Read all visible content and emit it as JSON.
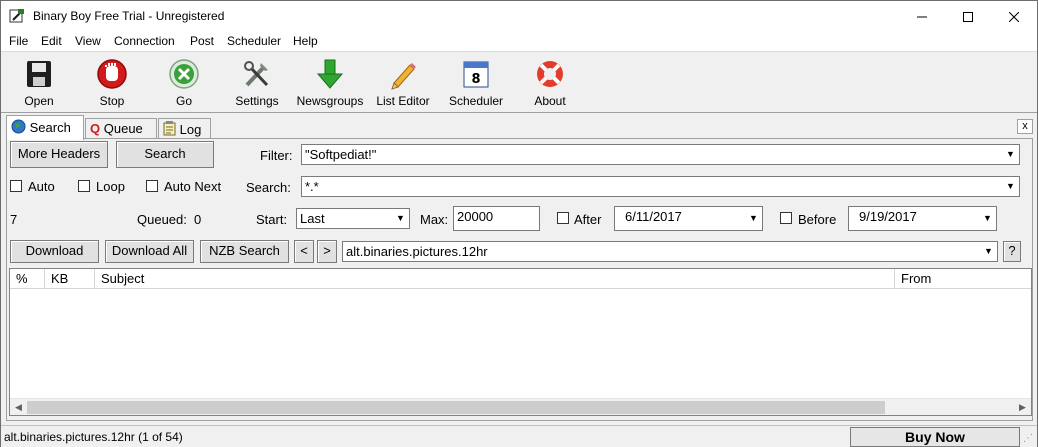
{
  "window": {
    "title": "Binary Boy Free Trial - Unregistered"
  },
  "menu": [
    "File",
    "Edit",
    "View",
    "Connection",
    "Post",
    "Scheduler",
    "Help"
  ],
  "toolbar": {
    "open": "Open",
    "stop": "Stop",
    "go": "Go",
    "settings": "Settings",
    "newsgroups": "Newsgroups",
    "list_editor": "List Editor",
    "scheduler": "Scheduler",
    "about": "About",
    "scheduler_date": "8"
  },
  "tabs": {
    "search": "Search",
    "queue": "Queue",
    "log": "Log",
    "close": "x"
  },
  "search": {
    "more_headers": "More Headers",
    "search_button": "Search",
    "filter_label": "Filter:",
    "filter_value": "\"Softpediat!\"",
    "search_label": "Search:",
    "search_value": "*.*",
    "auto": "Auto",
    "loop": "Loop",
    "auto_next": "Auto Next",
    "count": "7",
    "queued_label": "Queued:",
    "queued_value": "0",
    "start_label": "Start:",
    "start_value": "Last",
    "max_label": "Max:",
    "max_value": "20000",
    "after_label": "After",
    "after_date": "6/11/2017",
    "before_label": "Before",
    "before_date": "9/19/2017",
    "download": "Download",
    "download_all": "Download All",
    "nzb_search": "NZB Search",
    "prev": "<",
    "next": ">",
    "group": "alt.binaries.pictures.12hr",
    "help": "?"
  },
  "grid": {
    "columns": [
      "%",
      "KB",
      "Subject",
      "From"
    ]
  },
  "status": {
    "text": "alt.binaries.pictures.12hr (1 of 54)",
    "buy_now": "Buy Now"
  }
}
